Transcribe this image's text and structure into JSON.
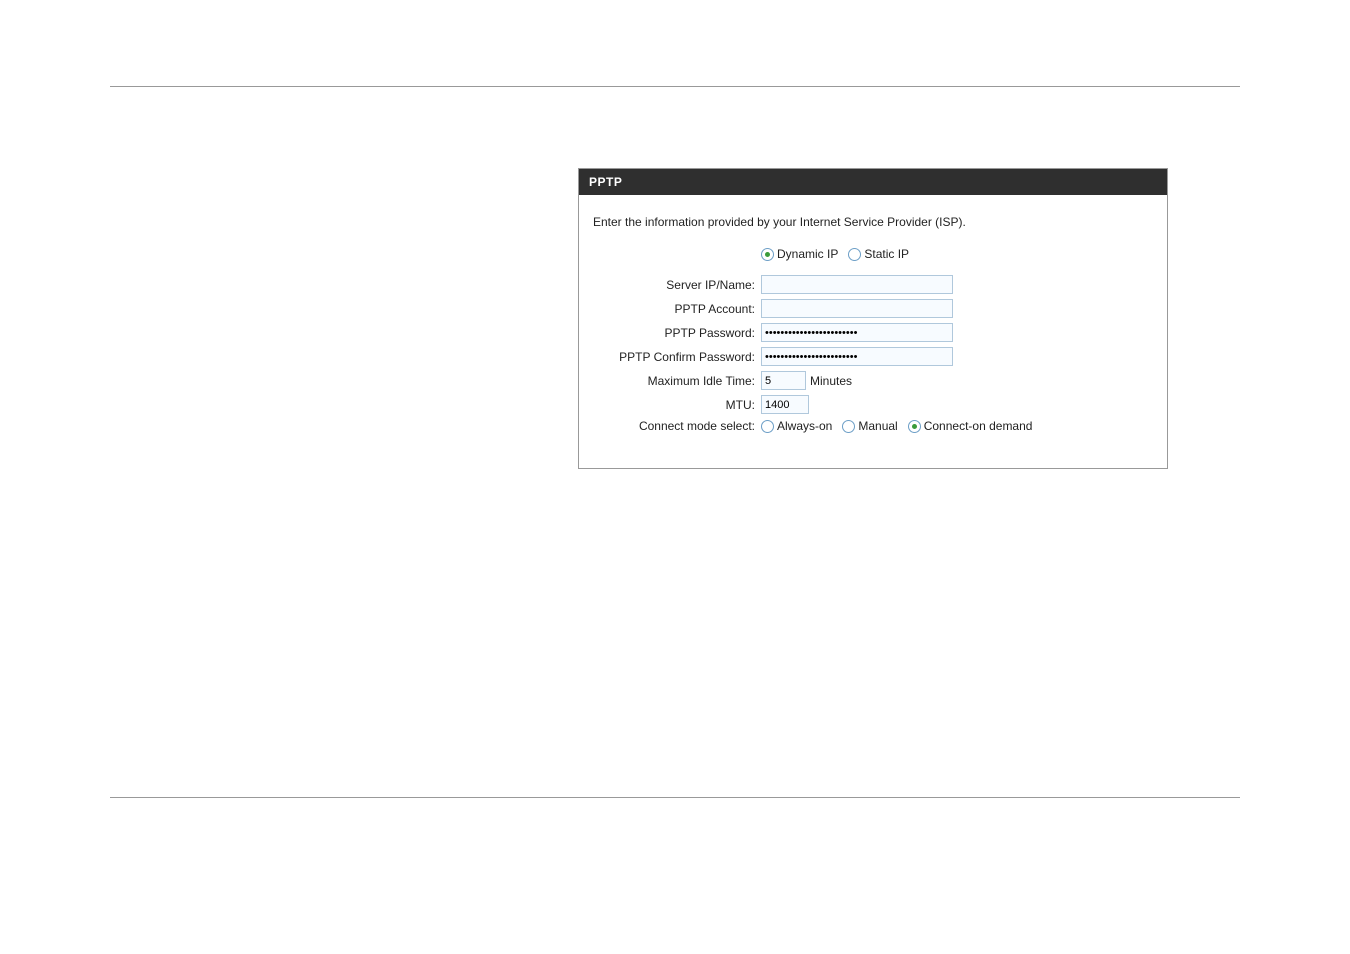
{
  "panel": {
    "title": "PPTP",
    "intro": "Enter the information provided by your Internet Service Provider (ISP)."
  },
  "ipMode": {
    "dynamic": "Dynamic IP",
    "static": "Static IP"
  },
  "labels": {
    "serverIp": "Server IP/Name:",
    "account": "PPTP Account:",
    "password": "PPTP Password:",
    "confirmPassword": "PPTP Confirm Password:",
    "maxIdle": "Maximum Idle Time:",
    "mtu": "MTU:",
    "connectMode": "Connect mode select:"
  },
  "values": {
    "serverIp": "",
    "account": "",
    "password": "••••••••••••••••••••••••",
    "confirmPassword": "••••••••••••••••••••••••",
    "maxIdle": "5",
    "mtu": "1400"
  },
  "suffixes": {
    "minutes": "Minutes"
  },
  "connectMode": {
    "alwaysOn": "Always-on",
    "manual": "Manual",
    "onDemand": "Connect-on demand"
  }
}
